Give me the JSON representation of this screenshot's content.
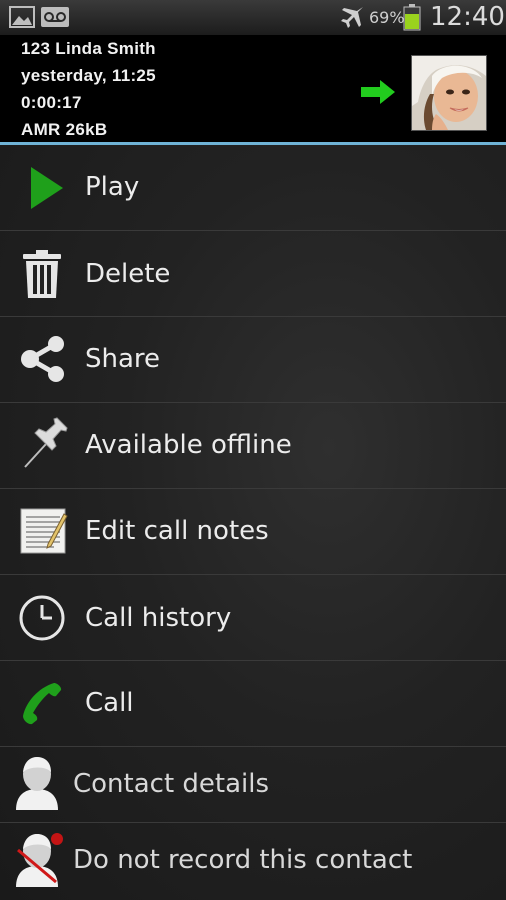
{
  "status_bar": {
    "battery_percent": "69%",
    "time": "12:40",
    "icons": [
      "image-notification-icon",
      "voicemail-icon",
      "airplane-mode-icon",
      "battery-icon"
    ]
  },
  "recording": {
    "number_name": "123  Linda Smith",
    "datetime": "yesterday, 11:25",
    "duration": "0:00:17",
    "format_size": "AMR  26kB",
    "direction_icon": "green-right-arrow-icon"
  },
  "colors": {
    "accent": "#6fb3d6",
    "green": "#2ea82a",
    "background": "#1f1f1f"
  },
  "menu": [
    {
      "label": "Play",
      "icon": "play-icon"
    },
    {
      "label": "Delete",
      "icon": "trash-icon"
    },
    {
      "label": "Share",
      "icon": "share-icon"
    },
    {
      "label": "Available offline",
      "icon": "pin-icon"
    },
    {
      "label": "Edit call notes",
      "icon": "notepad-icon"
    },
    {
      "label": "Call history",
      "icon": "clock-icon"
    },
    {
      "label": "Call",
      "icon": "phone-icon"
    },
    {
      "label": "Contact details",
      "icon": "contact-icon"
    },
    {
      "label": "Do not record this contact",
      "icon": "contact-no-record-icon"
    }
  ]
}
